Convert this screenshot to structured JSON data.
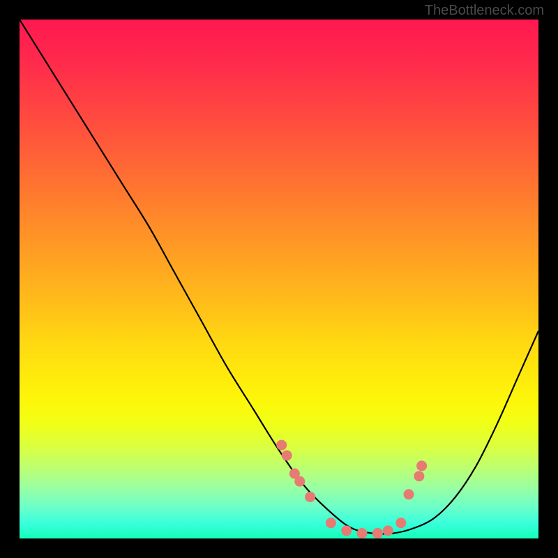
{
  "watermark": "TheBottleneck.com",
  "chart_data": {
    "type": "line",
    "title": "",
    "xlabel": "",
    "ylabel": "",
    "ylim": [
      0,
      100
    ],
    "xlim": [
      0,
      100
    ],
    "series": [
      {
        "name": "bottleneck-curve",
        "x": [
          0,
          5,
          10,
          15,
          20,
          25,
          30,
          35,
          40,
          45,
          50,
          55,
          60,
          64,
          68,
          72,
          76,
          80,
          84,
          88,
          92,
          96,
          100
        ],
        "y": [
          100,
          92,
          84,
          76,
          68,
          60,
          51,
          42,
          33,
          25,
          17,
          10,
          5,
          2,
          1,
          1,
          2,
          4,
          8,
          14,
          22,
          31,
          40
        ]
      }
    ],
    "markers": {
      "name": "data-points",
      "color": "#e77a72",
      "x": [
        50.5,
        51.5,
        53,
        54,
        56,
        60,
        63,
        66,
        69,
        71,
        73.5,
        75,
        77,
        77.5
      ],
      "y": [
        18,
        16,
        12.5,
        11,
        8,
        3,
        1.5,
        1,
        1,
        1.5,
        3,
        8.5,
        12,
        14
      ]
    }
  }
}
